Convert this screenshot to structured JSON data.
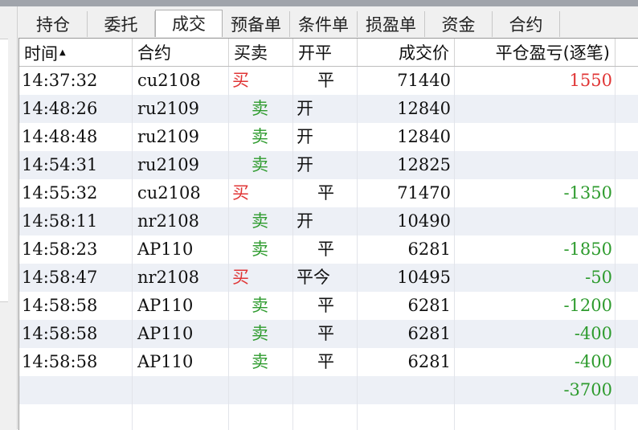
{
  "tabs": [
    {
      "label": "持仓",
      "width": 85
    },
    {
      "label": "委托",
      "width": 84
    },
    {
      "label": "成交",
      "width": 84
    },
    {
      "label": "预备单",
      "width": 84
    },
    {
      "label": "条件单",
      "width": 84
    },
    {
      "label": "损盈单",
      "width": 84
    },
    {
      "label": "资金",
      "width": 84
    },
    {
      "label": "合约",
      "width": 84
    }
  ],
  "active_tab": 2,
  "columns": {
    "time": "时间",
    "contract": "合约",
    "side": "买卖",
    "open_close": "开平",
    "price": "成交价",
    "pnl": "平仓盈亏(逐笔)"
  },
  "rows": [
    {
      "time": "14:37:32",
      "contract": "cu2108",
      "side": "买",
      "open_close": "平",
      "price": "71440",
      "pnl": "1550"
    },
    {
      "time": "14:48:26",
      "contract": "ru2109",
      "side": "卖",
      "open_close": "开",
      "price": "12840",
      "pnl": ""
    },
    {
      "time": "14:48:48",
      "contract": "ru2109",
      "side": "卖",
      "open_close": "开",
      "price": "12840",
      "pnl": ""
    },
    {
      "time": "14:54:31",
      "contract": "ru2109",
      "side": "卖",
      "open_close": "开",
      "price": "12825",
      "pnl": ""
    },
    {
      "time": "14:55:32",
      "contract": "cu2108",
      "side": "买",
      "open_close": "平",
      "price": "71470",
      "pnl": "-1350"
    },
    {
      "time": "14:58:11",
      "contract": "nr2108",
      "side": "卖",
      "open_close": "开",
      "price": "10490",
      "pnl": ""
    },
    {
      "time": "14:58:23",
      "contract": "AP110",
      "side": "卖",
      "open_close": "平",
      "price": "6281",
      "pnl": "-1850"
    },
    {
      "time": "14:58:47",
      "contract": "nr2108",
      "side": "买",
      "open_close": "平今",
      "price": "10495",
      "pnl": "-50"
    },
    {
      "time": "14:58:58",
      "contract": "AP110",
      "side": "卖",
      "open_close": "平",
      "price": "6281",
      "pnl": "-1200"
    },
    {
      "time": "14:58:58",
      "contract": "AP110",
      "side": "卖",
      "open_close": "平",
      "price": "6281",
      "pnl": "-400"
    },
    {
      "time": "14:58:58",
      "contract": "AP110",
      "side": "卖",
      "open_close": "平",
      "price": "6281",
      "pnl": "-400"
    }
  ],
  "total_pnl": "-3700",
  "colors": {
    "buy": "#e03535",
    "sell": "#2e9b2e"
  }
}
